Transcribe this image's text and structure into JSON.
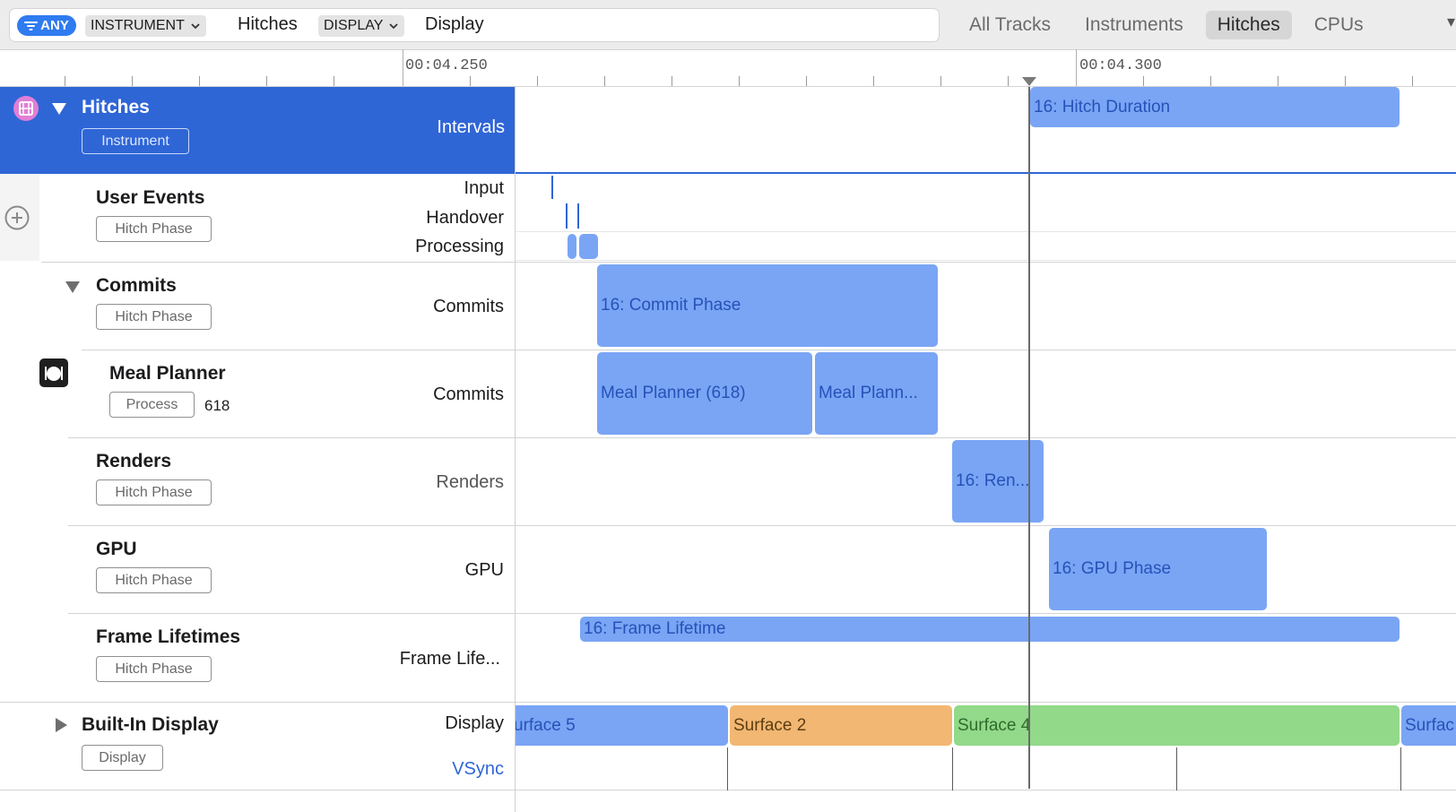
{
  "filter": {
    "any_label": "ANY",
    "instrument_token": "INSTRUMENT",
    "instrument_value": "Hitches",
    "display_token": "DISPLAY",
    "display_value": "Display"
  },
  "tabs": [
    "All Tracks",
    "Instruments",
    "Hitches",
    "CPUs"
  ],
  "active_tab": "Hitches",
  "ruler": {
    "label_1": "00:04.250",
    "label_2": "00:04.300"
  },
  "tracks": {
    "hitches": {
      "title": "Hitches",
      "badge": "Instrument",
      "lane": "Intervals",
      "bar": "16: Hitch Duration"
    },
    "user_events": {
      "title": "User Events",
      "badge": "Hitch Phase",
      "lanes": [
        "Input",
        "Handover",
        "Processing"
      ]
    },
    "commits": {
      "title": "Commits",
      "badge": "Hitch Phase",
      "lane": "Commits",
      "bar": "16: Commit Phase"
    },
    "meal_planner": {
      "title": "Meal Planner",
      "badge": "Process",
      "pid": "618",
      "lane": "Commits",
      "bar_1": "Meal Planner (618)",
      "bar_2": "Meal Plann..."
    },
    "renders": {
      "title": "Renders",
      "badge": "Hitch Phase",
      "lane": "Renders",
      "bar": "16: Ren..."
    },
    "gpu": {
      "title": "GPU",
      "badge": "Hitch Phase",
      "lane": "GPU",
      "bar": "16: GPU Phase"
    },
    "frame_lifetimes": {
      "title": "Frame Lifetimes",
      "badge": "Hitch Phase",
      "lane": "Frame Life...",
      "bar": "16: Frame Lifetime"
    },
    "built_in_display": {
      "title": "Built-In Display",
      "badge": "Display",
      "lane_display": "Display",
      "lane_vsync": "VSync",
      "surfaces": [
        "urface 5",
        "Surface 2",
        "Surface 4",
        "Surfac"
      ]
    }
  },
  "colors": {
    "selected_header": "#2f66d6",
    "bar_blue": "#7aa5f5",
    "surface_orange": "#f2b772",
    "surface_green": "#92d98a"
  }
}
